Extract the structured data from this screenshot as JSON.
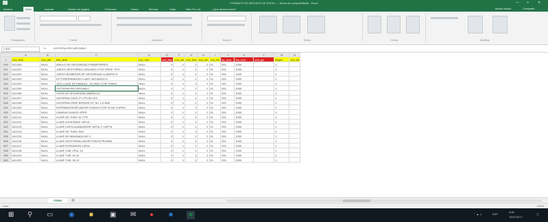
{
  "window": {
    "title": "FORMATO DE ARCHIVO DE EXCEL — Modo de compatibilidad - Excel",
    "controls": [
      "—",
      "□",
      "✕"
    ]
  },
  "ribbon_tabs": [
    "Archivo",
    "Inicio",
    "Insertar",
    "Diseño de página",
    "Fórmulas",
    "Datos",
    "Revisar",
    "Vista",
    "Nitro Pro 10",
    "¿Qué desea hacer?"
  ],
  "ribbon_right": [
    "Iniciar sesión",
    "Compartir"
  ],
  "ribbon_groups": [
    "Portapapeles",
    "Fuente",
    "Alineación",
    "Número",
    "Estilos",
    "Celdas",
    "Modificar"
  ],
  "formula_bar": {
    "name_box": "C496",
    "fx": "fx",
    "content": "LINTERNA RECARGABLE"
  },
  "columns": [
    "A",
    "B",
    "C",
    "D",
    "E",
    "F",
    "G",
    "H",
    "I",
    "J",
    "K",
    "L",
    "M",
    "N"
  ],
  "fields": [
    "cod_item",
    "cod_arti",
    "des_item",
    "cod_und",
    "cod_fam",
    "cod_cal",
    "cod_dcd",
    "cod_ser",
    "cod_lim",
    "tip_mon",
    "vta_mon",
    "cod_gsr",
    "afigen",
    "cod_alt"
  ],
  "field_colors": [
    "yellow",
    "yellow",
    "yellow",
    "yellow",
    "red",
    "yellow",
    "yellow",
    "yellow",
    "yellow",
    "red",
    "red",
    "red",
    "yellow",
    "yellow"
  ],
  "rows": [
    {
      "n": "540",
      "cells": [
        "A11200",
        "NULL",
        "ANILLO DE SEGURIDAD P/SIMPOPIRES",
        "NULL",
        "0",
        "1",
        "1",
        "2",
        "01",
        "001",
        "1000",
        "",
        "1",
        ""
      ]
    },
    {
      "n": "541",
      "cells": [
        "A11201",
        "NULL",
        "JUEGO DESTORNILL.AISLADO 6 PZS PROF. STH",
        "NULL",
        "0",
        "1",
        "1",
        "2",
        "01",
        "001",
        "1000",
        "",
        "1",
        ""
      ]
    },
    {
      "n": "542",
      "cells": [
        "A11202",
        "NULL",
        "JUEGO BOMBITAS DE SEGURIDAD LLAVERO E",
        "NULL",
        "0",
        "1",
        "1",
        "2",
        "01",
        "001",
        "1000",
        "",
        "1",
        ""
      ]
    },
    {
      "n": "543",
      "cells": [
        "A11203",
        "NULL",
        "KIT P/REPARADOR LLANT. NEUMATICO",
        "NULL",
        "0",
        "1",
        "1",
        "2",
        "01",
        "001",
        "1000",
        "",
        "1",
        ""
      ]
    },
    {
      "n": "544",
      "cells": [
        "A11204",
        "NULL",
        "JGO LLAVE DE MANDAL. 18 UNID COM. PIMAS",
        "NULL",
        "0",
        "1",
        "1",
        "2",
        "01",
        "001",
        "1000",
        "",
        "1",
        ""
      ]
    },
    {
      "n": "545",
      "cells": [
        "A11205",
        "NULL",
        "LINTERNA RECARGABLE",
        "NULL",
        "0",
        "1",
        "1",
        "2",
        "01",
        "001",
        "1000",
        "",
        "1",
        ""
      ]
    },
    {
      "n": "546",
      "cells": [
        "A11206",
        "NULL",
        "CINTA DE SEGURIDAD AMARILLA",
        "NULL",
        "0",
        "1",
        "1",
        "2",
        "01",
        "001",
        "1000",
        "",
        "1",
        ""
      ]
    },
    {
      "n": "547",
      "cells": [
        "A11207",
        "NULL",
        "LINTERNA CAVE ZT LPS 83 LEX",
        "NULL",
        "0",
        "1",
        "1",
        "2",
        "01",
        "001",
        "1000",
        "",
        "1",
        ""
      ]
    },
    {
      "n": "548",
      "cells": [
        "A11208",
        "NULL",
        "LINTERNA CREE BRIDGE KIT NC 1-5 NNK",
        "NULL",
        "0",
        "1",
        "1",
        "2",
        "01",
        "001",
        "1000",
        "",
        "1",
        ""
      ]
    },
    {
      "n": "549",
      "cells": [
        "A11209",
        "NULL",
        "EXPRIMIDOR/SECADOR CONDUCTOR 09 DE CUERO",
        "NULL",
        "0",
        "1",
        "1",
        "2",
        "01",
        "001",
        "1000",
        "",
        "1",
        ""
      ]
    },
    {
      "n": "550",
      "cells": [
        "A11210",
        "NULL",
        "CAMISA PLANOS UPER",
        "NULL",
        "0",
        "1",
        "1",
        "2",
        "01",
        "001",
        "1000",
        "",
        "1",
        ""
      ]
    },
    {
      "n": "551",
      "cells": [
        "A11211",
        "NULL",
        "LLAVE DE TUBO 10 2 PZ",
        "NULL",
        "0",
        "1",
        "1",
        "2",
        "01",
        "001",
        "1000",
        "",
        "1",
        ""
      ]
    },
    {
      "n": "552",
      "cells": [
        "A11212",
        "NULL",
        "LLAVE AJUSTABLE 10PUL",
        "NULL",
        "0",
        "1",
        "1",
        "2",
        "01",
        "001",
        "1000",
        "",
        "1",
        ""
      ]
    },
    {
      "n": "553",
      "cells": [
        "A11213",
        "NULL",
        "LLAVE CAPILLA/ANDADOR 10PUL 2 CAPTA",
        "NULL",
        "0",
        "1",
        "1",
        "2",
        "01",
        "001",
        "1000",
        "",
        "1",
        ""
      ]
    },
    {
      "n": "554",
      "cells": [
        "A11214",
        "NULL",
        "LLAVE DE TUBO 1M4",
        "NULL",
        "0",
        "1",
        "1",
        "2",
        "01",
        "001",
        "1000",
        "",
        "1",
        ""
      ]
    },
    {
      "n": "555",
      "cells": [
        "A11215",
        "NULL",
        "LLAVE DE MANDADA NO 3",
        "NULL",
        "0",
        "1",
        "1",
        "2",
        "01",
        "001",
        "1000",
        "",
        "1",
        ""
      ]
    },
    {
      "n": "556",
      "cells": [
        "A11216",
        "NULL",
        "LLAVE DESTORNILLADOR PUNTA PRUEBA",
        "NULL",
        "0",
        "1",
        "1",
        "2",
        "01",
        "001",
        "1000",
        "",
        "1",
        ""
      ]
    },
    {
      "n": "557",
      "cells": [
        "A11217",
        "NULL",
        "LLAVE EXPANSION 12PUL",
        "NULL",
        "0",
        "1",
        "1",
        "2",
        "01",
        "001",
        "1000",
        "",
        "1",
        ""
      ]
    },
    {
      "n": "558",
      "cells": [
        "A11218",
        "NULL",
        "LLAVE TUB. 1PUL 14",
        "NULL",
        "0",
        "1",
        "1",
        "2",
        "01",
        "001",
        "1000",
        "",
        "1",
        ""
      ]
    },
    {
      "n": "559",
      "cells": [
        "A11219",
        "NULL",
        "LLAVE TUB. 16 12",
        "NULL",
        "0",
        "1",
        "1",
        "2",
        "01",
        "001",
        "1000",
        "",
        "1",
        ""
      ]
    },
    {
      "n": "560",
      "cells": [
        "A11220",
        "NULL",
        "LLAVE TUB. 18 12",
        "NULL",
        "0",
        "1",
        "1",
        "2",
        "01",
        "001",
        "1000",
        "",
        "1",
        ""
      ]
    }
  ],
  "sheet_tab": "ITEMS",
  "status": {
    "left": "Listo",
    "zoom": "100%"
  },
  "tray": {
    "lang": "ESP",
    "time": "8:58",
    "date": "15/11/2017"
  }
}
